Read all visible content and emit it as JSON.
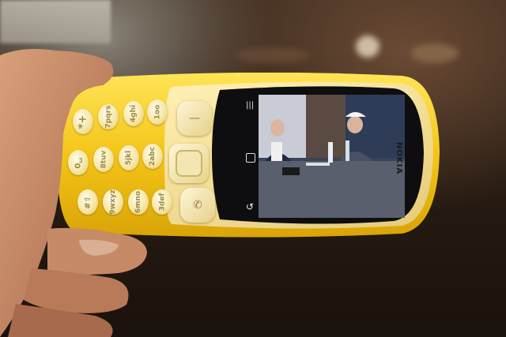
{
  "phone": {
    "brand": "NOKIA",
    "body_color": "#f2c21a",
    "keypad": [
      {
        "name": "key-star",
        "label": "*+"
      },
      {
        "name": "key-7",
        "label": "7pqrs"
      },
      {
        "name": "key-4",
        "label": "4ghi"
      },
      {
        "name": "key-1",
        "label": "1oo"
      },
      {
        "name": "key-0",
        "label": "0␣"
      },
      {
        "name": "key-8",
        "label": "8tuv"
      },
      {
        "name": "key-5",
        "label": "5jkl"
      },
      {
        "name": "key-2",
        "label": "2abc"
      },
      {
        "name": "key-hash",
        "label": "#⇧"
      },
      {
        "name": "key-9",
        "label": "9wxyz"
      },
      {
        "name": "key-6",
        "label": "6mno"
      },
      {
        "name": "key-3",
        "label": "3def"
      }
    ]
  }
}
